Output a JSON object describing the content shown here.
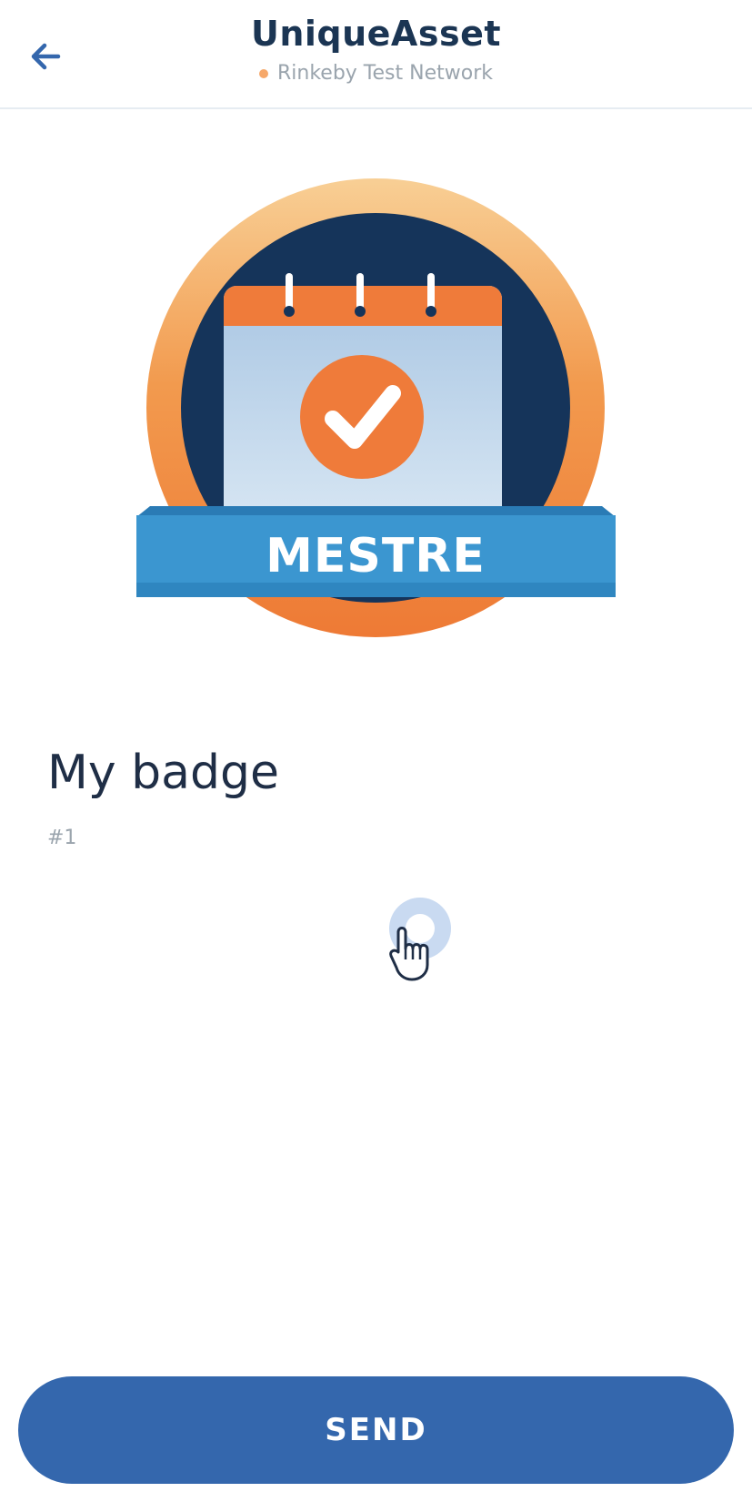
{
  "header": {
    "title": "UniqueAsset",
    "network": "Rinkeby Test Network",
    "network_dot_color": "#f6a86a",
    "back_icon": "arrow-left-icon"
  },
  "asset": {
    "image_text": "MESTRE",
    "name": "My badge",
    "id": "#1"
  },
  "colors": {
    "accent": "#3467ad",
    "badge_ring": "#f08a3c",
    "badge_navy": "#15345a",
    "calendar_blue": "#b8d1e8",
    "banner_blue": "#3b96d0"
  },
  "actions": {
    "send_label": "SEND"
  }
}
